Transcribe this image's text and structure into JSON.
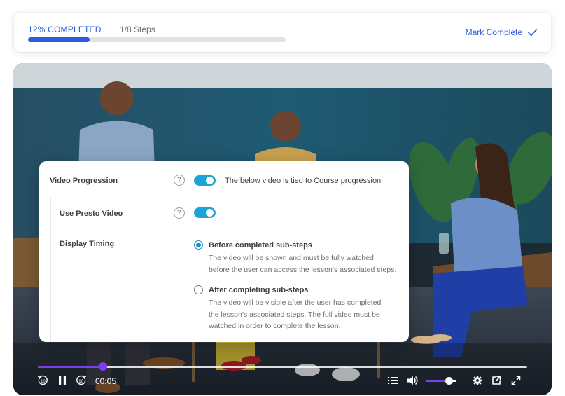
{
  "progress": {
    "percent_label": "12% COMPLETED",
    "percent": 0.12,
    "steps_label": "1/8 Steps",
    "mark_complete_label": "Mark Complete"
  },
  "panel": {
    "video_progression": {
      "label": "Video Progression",
      "help": "?",
      "toggle_on": true,
      "description": "The below video is tied to Course progression"
    },
    "use_presto": {
      "label": "Use Presto Video",
      "help": "?",
      "toggle_on": true
    },
    "display_timing": {
      "label": "Display Timing",
      "options": [
        {
          "title": "Before completed sub-steps",
          "lines": [
            "The video will be shown and must be fully watched",
            "before the user can access the lesson’s associated steps."
          ],
          "checked": true
        },
        {
          "title": "After completing sub-steps",
          "lines": [
            "The video will be visible after the user has completed",
            "the lesson’s associated steps. The full video must be",
            "watched in order to complete the lesson."
          ],
          "checked": false
        }
      ]
    }
  },
  "player": {
    "time": "00:05",
    "played_fraction": 0.133,
    "volume": 0.75,
    "icons": {
      "rewind": "rewind-10-icon",
      "play_pause": "pause-icon",
      "forward": "forward-10-icon",
      "chapters": "list-icon",
      "volume": "volume-icon",
      "settings": "gear-icon",
      "popout": "popout-icon",
      "fullscreen": "fullscreen-icon"
    },
    "colors": {
      "accent": "#7a3ff0",
      "toggle": "#1ea3d8",
      "brand": "#2d5bdb"
    }
  }
}
